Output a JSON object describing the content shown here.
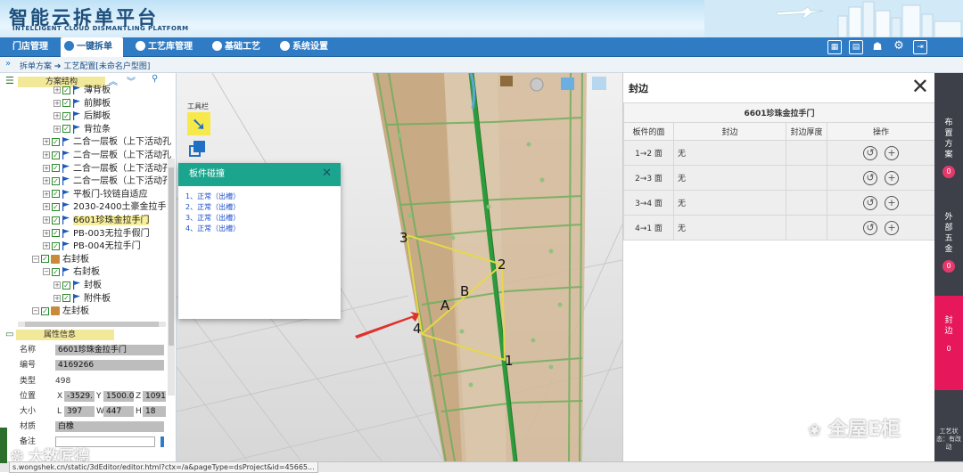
{
  "header": {
    "logo_cn": "智能云拆单平台",
    "logo_en": "INTELLIGENT CLOUD DISMANTLING PLATFORM"
  },
  "nav": {
    "items": [
      {
        "label": "门店管理"
      },
      {
        "label": "一键拆单",
        "active": true
      },
      {
        "label": "工艺库管理"
      },
      {
        "label": "基础工艺"
      },
      {
        "label": "系统设置"
      }
    ],
    "accent": "#2f7bc4"
  },
  "breadcrumb": {
    "root": "拆单方案",
    "current": "工艺配置[未命名户型图]"
  },
  "tree": {
    "title": "方案结构",
    "items": [
      {
        "label": "薄背板",
        "level": 2
      },
      {
        "label": "前脚板",
        "level": 2
      },
      {
        "label": "后脚板",
        "level": 2
      },
      {
        "label": "背拉条",
        "level": 2
      },
      {
        "label": "二合一层板（上下活动孔",
        "level": 1
      },
      {
        "label": "二合一层板（上下活动孔",
        "level": 1
      },
      {
        "label": "二合一层板（上下活动孔",
        "level": 1
      },
      {
        "label": "二合一层板（上下活动孔",
        "level": 1
      },
      {
        "label": "平板门-铰链自适应",
        "level": 1
      },
      {
        "label": "2030-2400土豪金拉手",
        "level": 1
      },
      {
        "label": "6601珍珠金拉手门",
        "level": 1,
        "selected": true
      },
      {
        "label": "PB-003无拉手假门",
        "level": 1
      },
      {
        "label": "PB-004无拉手门",
        "level": 1
      },
      {
        "label": "右封板",
        "level": 0,
        "box": true
      },
      {
        "label": "右封板",
        "level": 1
      },
      {
        "label": "封板",
        "level": 2
      },
      {
        "label": "附件板",
        "level": 2
      },
      {
        "label": "左封板",
        "level": 0,
        "box": true
      }
    ]
  },
  "props": {
    "title": "属性信息",
    "name_label": "名称",
    "name": "6601珍珠金拉手门",
    "code_label": "编号",
    "code": "4169266",
    "type_label": "类型",
    "type": "498",
    "pos_label": "位置",
    "x": "-3529.",
    "y": "1500.0",
    "z": "1091",
    "size_label": "大小",
    "l": "397",
    "w": "447",
    "h": "18",
    "material_label": "材质",
    "material": "白橡",
    "note_label": "备注"
  },
  "toolbar": {
    "label": "工具栏"
  },
  "collision": {
    "title": "板件碰撞",
    "items": [
      "1、正常（出槽）",
      "2、正常（出槽）",
      "3、正常（出槽）",
      "4、正常（出槽）"
    ]
  },
  "model_labels": {
    "p1": "1",
    "p2": "2",
    "p3": "3",
    "p4": "4",
    "a": "A",
    "b": "B"
  },
  "edge": {
    "title": "封边",
    "table_title": "6601珍珠金拉手门",
    "headers": [
      "板件的面",
      "封边",
      "封边厚度",
      "操作"
    ],
    "rows": [
      {
        "face": "1→2 面",
        "edge": "无"
      },
      {
        "face": "2→3 面",
        "edge": "无"
      },
      {
        "face": "3→4 面",
        "edge": "无"
      },
      {
        "face": "4→1 面",
        "edge": "无"
      }
    ]
  },
  "sidebar": {
    "items": [
      {
        "label": "布置方案",
        "badge": "0"
      },
      {
        "label": "外部五金",
        "badge": "0"
      },
      {
        "label": "封边",
        "badge": "0"
      }
    ],
    "footer": "工艺状态：有改动"
  },
  "status": {
    "url": "s.wongshek.cn/static/3dEditor/editor.html?ctx=/a&pageType=dsProject&id=45665..."
  },
  "watermarks": {
    "w1": "全屋E柜",
    "w2": "大数匠德"
  }
}
